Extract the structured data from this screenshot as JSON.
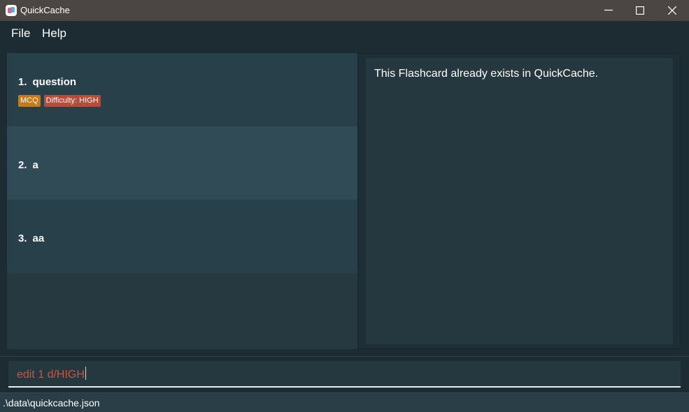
{
  "window": {
    "title": "QuickCache",
    "icon": "quickcache-app-icon",
    "controls": [
      "minimize-icon",
      "maximize-icon",
      "close-icon"
    ]
  },
  "menu": {
    "file": "File",
    "help": "Help"
  },
  "flashcards": [
    {
      "index": "1.",
      "question": "question",
      "tags": [
        "MCQ",
        "Difficulty: HIGH"
      ]
    },
    {
      "index": "2.",
      "question": "a",
      "tags": []
    },
    {
      "index": "3.",
      "question": "aa",
      "tags": []
    }
  ],
  "result": {
    "message": "This Flashcard already exists in QuickCache."
  },
  "command": {
    "value": "edit 1 d/HIGH"
  },
  "status": {
    "file_path": ".\\data\\quickcache.json"
  },
  "colors": {
    "background": "#1d2b33",
    "title_bar": "#4b4644",
    "tag_mcq": "#c87a17",
    "tag_difficulty": "#bb4b37",
    "command_error_text": "#c8553f"
  }
}
